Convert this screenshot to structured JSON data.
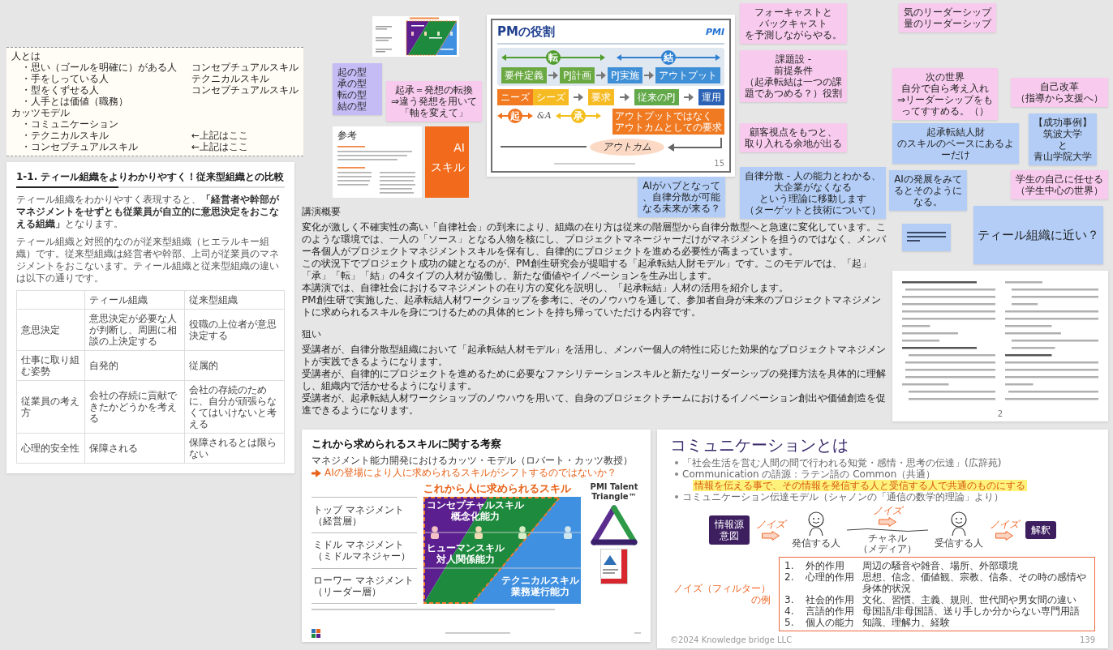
{
  "notes_document": {
    "sections": [
      {
        "heading": "人とは",
        "items": [
          {
            "text": "・思い（ゴールを明確に）がある人",
            "tag": "コンセプチュアルスキル"
          },
          {
            "text": "・手をしっている人",
            "tag": "テクニカルスキル"
          },
          {
            "text": "・型をくずせる人",
            "tag": "コンセプチュアルスキル"
          },
          {
            "text": "・人手とは価値（職務）"
          }
        ]
      },
      {
        "heading": "カッツモデル",
        "items": [
          {
            "text": "・コミュニケーション"
          },
          {
            "text": "・テクニカルスキル",
            "tag": "←上記はここ"
          },
          {
            "text": "・コンセプチュアルスキル",
            "tag": "←上記はここ"
          }
        ]
      }
    ]
  },
  "reference_document": {
    "heading": "参考"
  },
  "label_card": {
    "lines": [
      "AI",
      "スキル"
    ]
  },
  "pm_slide": {
    "title": "PMの役割",
    "logo": "PMI",
    "upper_phases": [
      {
        "label": "転",
        "color": "#4f9d2d"
      },
      {
        "label": "結",
        "color": "#2f80d1"
      }
    ],
    "upper_flow": [
      {
        "label": "要件定義",
        "color": "#6aa842"
      },
      {
        "label": "PJ計画",
        "color": "#6aa842"
      },
      {
        "label": "PJ実施",
        "color": "#3f8fd6"
      },
      {
        "label": "アウトプット",
        "color": "#3f8fd6"
      }
    ],
    "lower_flow": [
      [
        {
          "label": "ニーズ",
          "color": "#f27b21"
        },
        {
          "label": "シーズ",
          "color": "#f6bb22"
        }
      ],
      [
        {
          "label": "要求",
          "color": "#f6bb22"
        }
      ],
      [
        {
          "label": "従来のPJ",
          "color": "#62a94a"
        }
      ],
      [
        {
          "label": "運用",
          "color": "#2c62b5"
        }
      ]
    ],
    "lower_phases": [
      {
        "label": "起",
        "color": "#f07420"
      },
      {
        "label": "承",
        "color": "#f3bf1c"
      }
    ],
    "connector": "&A",
    "callout": [
      "アウトプットではなく",
      "アウトカムとしての要求"
    ],
    "outcome": "アウトカム",
    "page": "15"
  },
  "sticky_notes": [
    {
      "kind": "text",
      "color": "#f8cbee",
      "lines": [
        "フォーキャストと",
        "バックキャスト",
        "を予測しながらやる。"
      ]
    },
    {
      "kind": "text",
      "color": "#f8cbee",
      "lines": [
        "気のリーダーシップ",
        "量のリーダーシップ"
      ]
    },
    {
      "kind": "text",
      "color": "#c5bcf6",
      "lines": [
        "起の型",
        "承の型",
        "転の型",
        "結の型"
      ]
    },
    {
      "kind": "text",
      "color": "#f8cbee",
      "lines": [
        "起承＝発想の転換",
        "⇒違う発想を用いて",
        "「軸を変えて」"
      ]
    },
    {
      "kind": "text",
      "color": "#f8cbee",
      "lines": [
        "課題設 -",
        "前提条件",
        "（起承転結は一つの課",
        "題であつめる？）役割"
      ]
    },
    {
      "kind": "text",
      "color": "#f8cbee",
      "lines": [
        "次の世界",
        "自分で自ら考え入れ",
        "⇒リーダーシップをも",
        "ってすすめる。（）"
      ]
    },
    {
      "kind": "text",
      "color": "#f8cbee",
      "lines": [
        "自己改革",
        "（指導から支援へ）"
      ]
    },
    {
      "kind": "text",
      "color": "#f8cbee",
      "lines": [
        "顧客視点をもつと、",
        "取り入れる余地が出る"
      ]
    },
    {
      "kind": "text",
      "color": "#b3cdf6",
      "lines": [
        "起承転結人財",
        "のスキルのベースにあるよ",
        "ーだけ"
      ]
    },
    {
      "kind": "text",
      "color": "#b3cdf6",
      "lines": [
        "【成功事例】",
        "筑波大学",
        "と",
        "青山学院大学"
      ]
    },
    {
      "kind": "text",
      "color": "#b3cdf6",
      "lines": [
        "AIがハブとなって",
        "、自律分散が可能",
        "なる未来が来る？"
      ]
    },
    {
      "kind": "text",
      "color": "#b3cdf6",
      "lines": [
        "自律分散 - 人の能力とわかる、",
        "大企業がなくなる",
        "という理論に移動します",
        "（ターゲットと技術について）"
      ]
    },
    {
      "kind": "text",
      "color": "#b3cdf6",
      "lines": [
        "AIの発展をみて",
        "るとそのように",
        "なる。"
      ]
    },
    {
      "kind": "text",
      "color": "#f8cbee",
      "lines": [
        "学生の自己に任せる",
        "（学生中心の世界）"
      ]
    },
    {
      "kind": "lines",
      "color": "#b3cdf6"
    },
    {
      "kind": "large",
      "color": "#b3cdf6",
      "lines": [
        "ティール組織に近い？"
      ]
    }
  ],
  "talk": {
    "sections": [
      {
        "heading": "講演概要",
        "paragraphs": [
          "変化が激しく不確実性の高い「自律社会」の到来により、組織の在り方は従来の階層型から自律分散型へと急速に変化しています。このような環境では、一人の「ソース」となる人物を核にし、プロジェクトマネージャーだけがマネジメントを担うのではなく、メンバー各個人がプロジェクトマネジメントスキルを保有し、自律的にプロジェクトを進める必要性が高まっています。",
          "この状況下でプロジェクト成功の鍵となるのが、PM創生研究会が提唱する「起承転結人財モデル」です。このモデルでは、「起」「承」「転」「結」の4タイプの人材が協働し、新たな価値やイノベーションを生み出します。",
          "本講演では、自律社会におけるマネジメントの在り方の変化を説明し、「起承転結」人材の活用を紹介します。",
          "PM創生研で実施した、起承転結人材ワークショップを参考に、そのノウハウを通して、参加者自身が未来のプロジェクトマネジメントに求められるスキルを身につけるための具体的ヒントを持ち帰っていただける内容です。"
        ]
      },
      {
        "heading": "狙い",
        "paragraphs": [
          "受講者が、自律分散型組織において「起承転結人材モデル」を活用し、メンバー個人の特性に応じた効果的なプロジェクトマネジメントが実践できるようになります。",
          "受講者が、自律的にプロジェクトを進めるために必要なファシリテーションスキルと新たなリーダーシップの発揮方法を具体的に理解し、組織内で活かせるようになります。",
          "受講者が、起承転結人材ワークショップのノウハウを用いて、自身のプロジェクトチームにおけるイノベーション創出や価値創造を促進できるようになります。"
        ]
      }
    ]
  },
  "comparison_card": {
    "title": "1-1. ティール組織をよりわかりやすく！従来型組織との比較",
    "paragraphs": [
      "ティール組織をわかりやすく表現すると、**「経営者や幹部がマネジメントをせずとも従業員が自立的に意思決定をおこなえる組織」**となります。",
      "ティール組織と対照的なのが従来型組織（ヒエラルキー組織）です。従来型組織は経営者や幹部、上司が従業員のマネジメントをおこないます。ティール組織と従来型組織の違いは以下の通りです。"
    ],
    "table": {
      "columns": [
        "ティール組織",
        "従来型組織"
      ],
      "rows": [
        {
          "label": "意思決定",
          "cells": [
            "意思決定が必要な人が判断し、周囲に相談の上決定する",
            "役職の上位者が意思決定する"
          ]
        },
        {
          "label": "仕事に取り組む姿勢",
          "cells": [
            "自発的",
            "従属的"
          ]
        },
        {
          "label": "従業員の考え方",
          "cells": [
            "会社の存続に貢献できたかどうかを考える",
            "会社の存続のために、自分が頑張らなくてはいけないと考える"
          ]
        },
        {
          "label": "心理的安全性",
          "cells": [
            "保障される",
            "保障されるとは限らない"
          ]
        }
      ]
    }
  },
  "document_page": {
    "page": "2"
  },
  "skills_slide": {
    "title": "これから求められるスキルに関する考察",
    "subtitle": "マネジメント能力開発におけるカッツ・モデル（ロバート・カッツ教授）",
    "question": "AIの登場により人に求められるスキルがシフトするのではないか？",
    "chart_heading": "これから人に求められるスキル",
    "levels": [
      {
        "name": "トップ マネジメント",
        "group": "（経営層）"
      },
      {
        "name": "ミドル マネジメント",
        "group": "（ミドルマネジャー）"
      },
      {
        "name": "ローワー マネジメント",
        "group": "（リーダー層）"
      }
    ],
    "skills": [
      {
        "name": "コンセプチャルスキル",
        "ability": "概念化能力",
        "color": "#5b1f8f"
      },
      {
        "name": "ヒューマンスキル",
        "ability": "対人関係能力",
        "color": "#1e8a3e"
      },
      {
        "name": "テクニカルスキル",
        "ability": "業務遂行能力",
        "color": "#3f90e0"
      }
    ],
    "triangle_title": "PMI Talent Triangle™"
  },
  "communication_slide": {
    "title": "コミュニケーションとは",
    "bullets": [
      {
        "kind": "bullet",
        "text": "「社会生活を営む人間の間で行われる知覚・感情・思考の伝達」(広辞苑)"
      },
      {
        "kind": "bullet",
        "text": "Communication の語源：ラテン語の Common（共通）"
      },
      {
        "kind": "highlight",
        "text": "情報を伝える事で、その情報を発信する人と受信する人で共通のものにする"
      },
      {
        "kind": "bullet",
        "text": "コミュニケーション伝達モデル（シャノンの「通信の数学的理論」より）"
      }
    ],
    "model": {
      "source": [
        "情報源",
        "意図"
      ],
      "noise": [
        "ノイズ",
        "ノイズ",
        "ノイズ"
      ],
      "sender": "発信する人",
      "channel": [
        "チャネル",
        "（メディア）"
      ],
      "receiver": "受信する人",
      "destination": "解釈"
    },
    "noise_heading": "ノイズ（フィルター）の例",
    "noise_examples": [
      {
        "number": "1.",
        "type": "外的作用",
        "examples": "周辺の騒音や雑音、場所、外部環境"
      },
      {
        "number": "2.",
        "type": "心理的作用",
        "examples": "思想、信念、価値観、宗教、信条、その時の感情や身体的状況"
      },
      {
        "number": "3.",
        "type": "社会的作用",
        "examples": "文化、習慣、主義、規則、世代間や男女間の違い"
      },
      {
        "number": "4.",
        "type": "言語的作用",
        "examples": "母国語/非母国語、送り手しか分からない専門用語"
      },
      {
        "number": "5.",
        "type": "個人の能力",
        "examples": "知識、理解力、経験"
      }
    ],
    "footer": "©2024 Knowledge bridge LLC",
    "page": "139"
  }
}
